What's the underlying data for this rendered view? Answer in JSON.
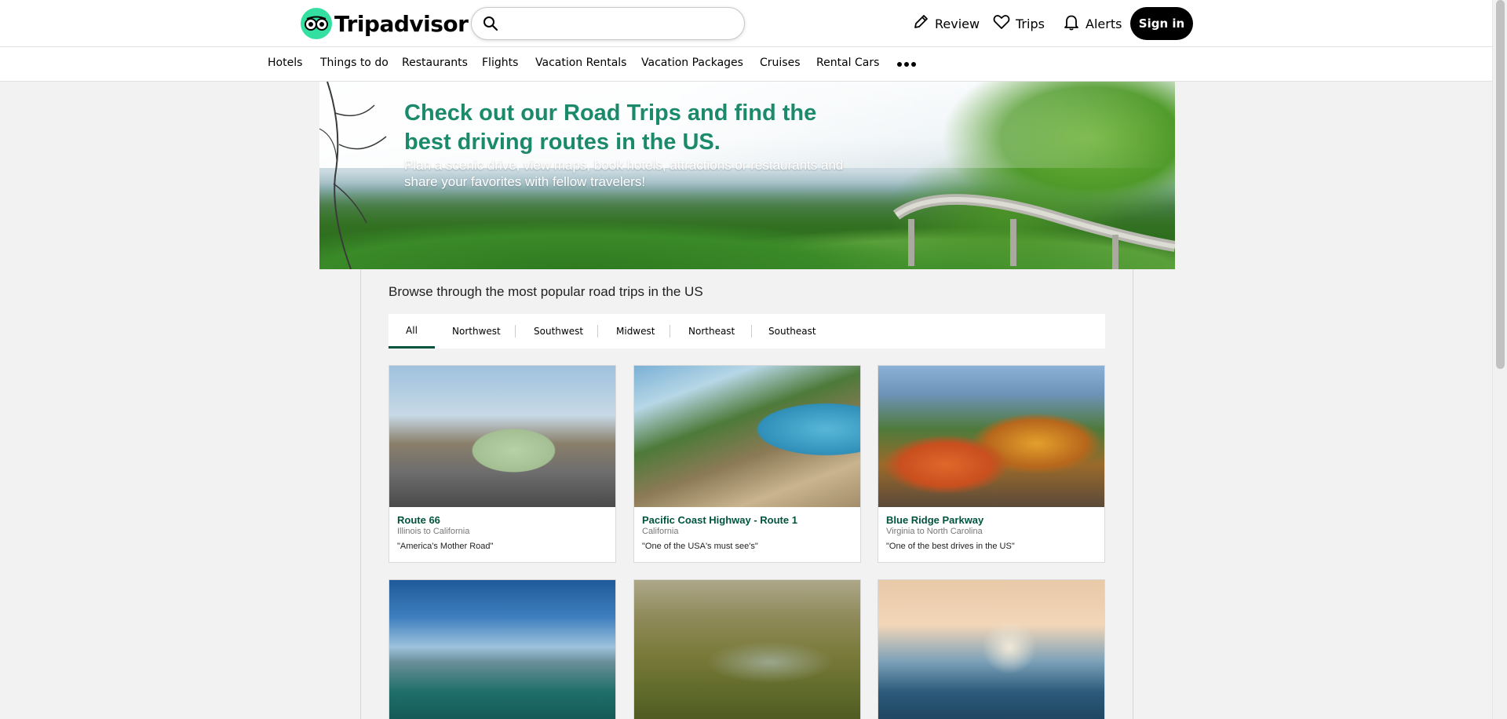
{
  "header": {
    "logo_text": "Tripadvisor",
    "search": {
      "placeholder": "",
      "value": ""
    },
    "actions": [
      {
        "label": "Review",
        "icon": "pencil-icon"
      },
      {
        "label": "Trips",
        "icon": "heart-icon"
      },
      {
        "label": "Alerts",
        "icon": "bell-icon"
      }
    ],
    "signin_label": "Sign in"
  },
  "catnav": {
    "items": [
      "Hotels",
      "Things to do",
      "Restaurants",
      "Flights",
      "Vacation Rentals",
      "Vacation Packages",
      "Cruises",
      "Rental Cars"
    ],
    "more_icon": "more-dots-icon"
  },
  "banner": {
    "heading": "Check out our Road Trips and find the best driving routes in the US.",
    "subtext": "Plan a scenic drive, view maps, book hotels, attractions or restaurants and share your favorites with fellow travelers!"
  },
  "main": {
    "intro": "Browse through the most popular road trips in the US",
    "tabs": [
      "All",
      "Northwest",
      "Southwest",
      "Midwest",
      "Northeast",
      "Southeast"
    ],
    "active_tab": "All",
    "cards": [
      {
        "title": "Route 66",
        "location": "Illinois to California",
        "quote": "\"America's Mother Road\""
      },
      {
        "title": "Pacific Coast Highway - Route 1",
        "location": "California",
        "quote": "\"One of the USA's must see's\""
      },
      {
        "title": "Blue Ridge Parkway",
        "location": "Virginia to North Carolina",
        "quote": "\"One of the best drives in the US\""
      },
      {
        "title": "",
        "location": "",
        "quote": ""
      },
      {
        "title": "",
        "location": "",
        "quote": ""
      },
      {
        "title": "",
        "location": "",
        "quote": ""
      }
    ]
  },
  "colors": {
    "brand_green": "#34e0a1",
    "link_green": "#00543d",
    "heading_teal": "#1b8a6b"
  }
}
